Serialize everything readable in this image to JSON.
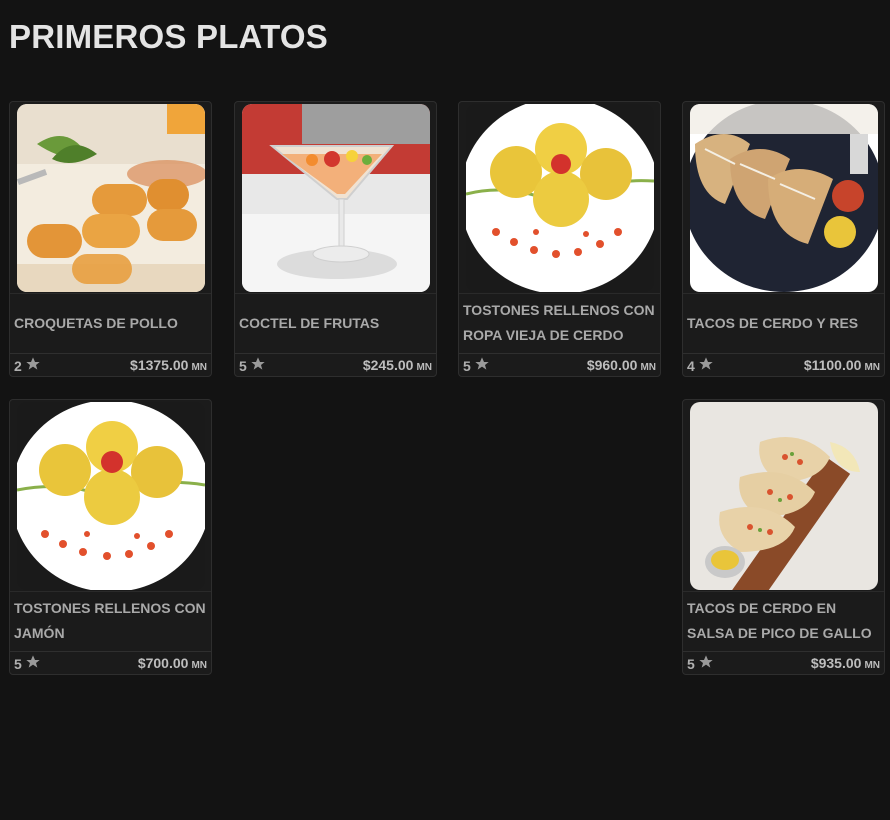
{
  "section": {
    "title": "PRIMEROS PLATOS"
  },
  "theme": {
    "background": "#131313",
    "card": "#1b1b1b",
    "text": "#a9a9a9"
  },
  "dishes": [
    {
      "name": "CROQUETAS DE POLLO",
      "rating": "2",
      "rating_icon": "star-icon",
      "price": "$1375.00",
      "currency": "MN"
    },
    {
      "name": "COCTEL DE FRUTAS",
      "rating": "5",
      "rating_icon": "star-icon",
      "price": "$245.00",
      "currency": "MN"
    },
    {
      "name": "TOSTONES RELLENOS CON ROPA VIEJA DE CERDO",
      "rating": "5",
      "rating_icon": "star-icon",
      "price": "$960.00",
      "currency": "MN"
    },
    {
      "name": "TACOS DE CERDO Y RES",
      "rating": "4",
      "rating_icon": "star-icon",
      "price": "$1100.00",
      "currency": "MN"
    },
    {
      "name": "TOSTONES RELLENOS CON JAMÓN",
      "rating": "5",
      "rating_icon": "star-icon",
      "price": "$700.00",
      "currency": "MN"
    },
    {
      "name": "TACOS DE CERDO EN SALSA DE PICO DE GALLO",
      "rating": "5",
      "rating_icon": "star-icon",
      "price": "$935.00",
      "currency": "MN"
    }
  ]
}
